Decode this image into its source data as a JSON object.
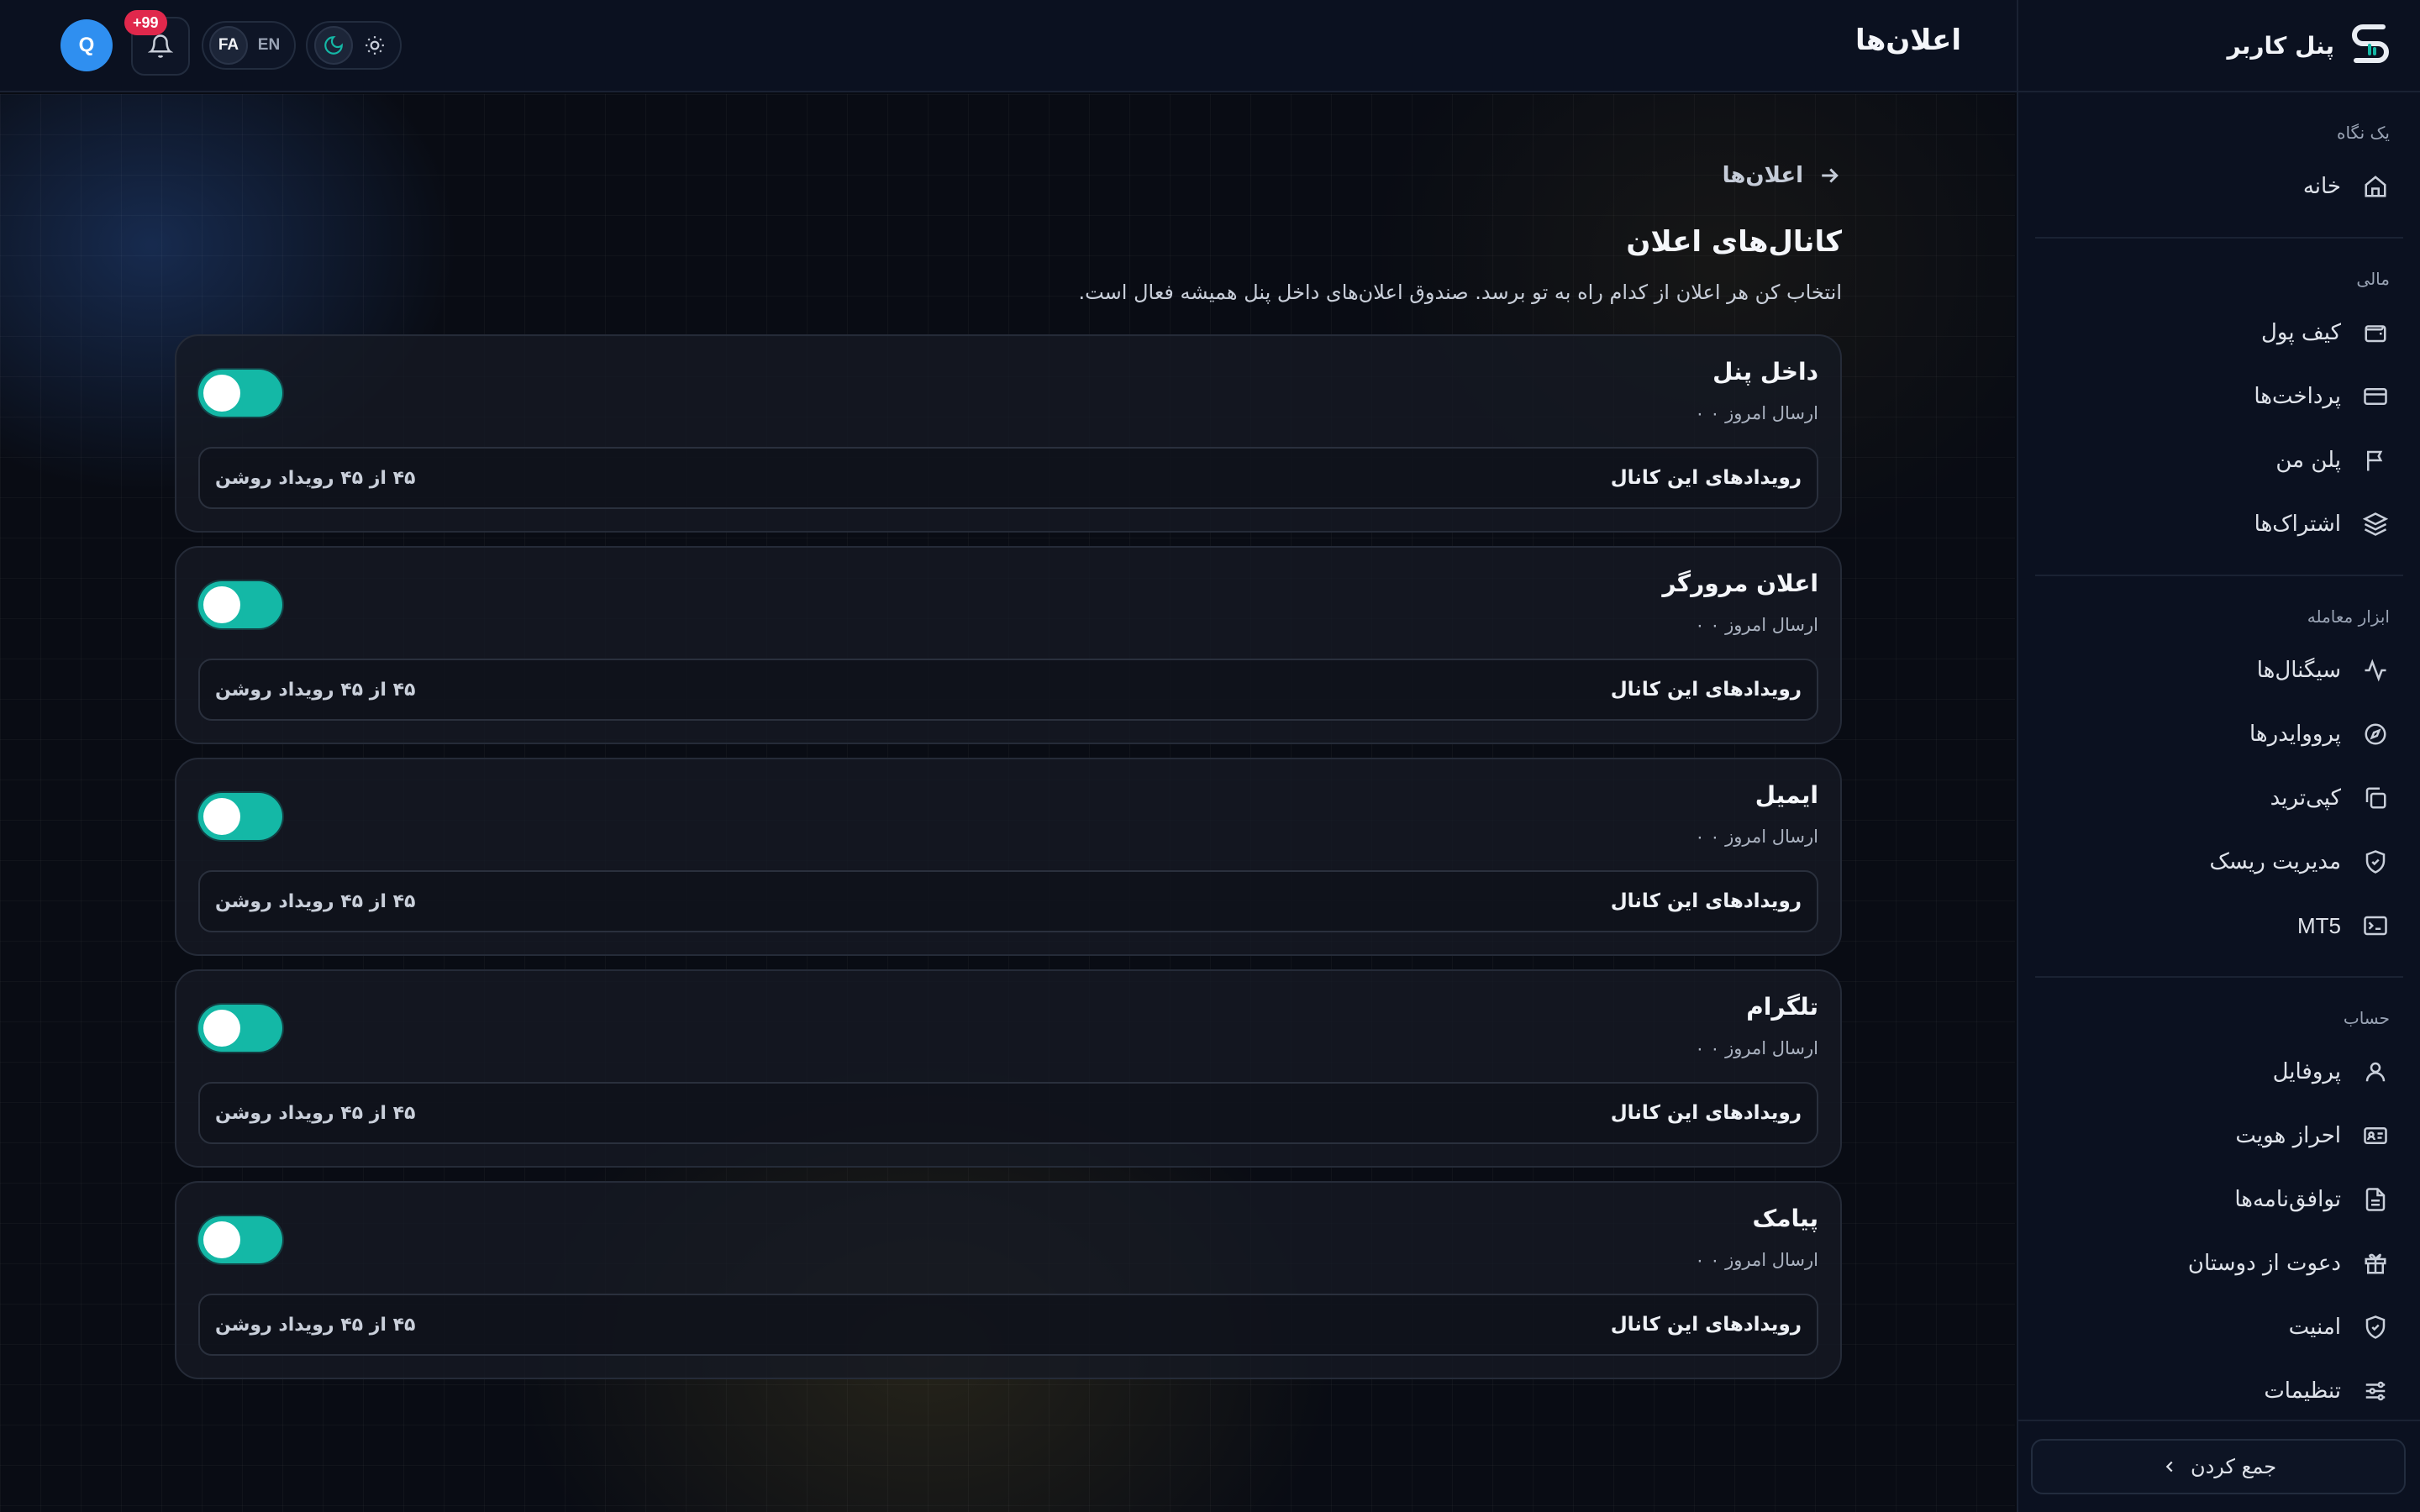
{
  "app": {
    "title": "پنل کاربر",
    "page_title": "اعلان‌ها",
    "collapse_label": "جمع کردن"
  },
  "topbar": {
    "avatar_initial": "Q",
    "notifications_badge": "+99",
    "lang_fa": "FA",
    "lang_en": "EN",
    "active_lang": "FA",
    "active_theme": "dark"
  },
  "sidebar": {
    "groups": [
      {
        "label": "یک نگاه",
        "items": [
          {
            "label": "خانه",
            "icon": "home-icon"
          }
        ]
      },
      {
        "label": "مالی",
        "items": [
          {
            "label": "کیف پول",
            "icon": "wallet-icon"
          },
          {
            "label": "پرداخت‌ها",
            "icon": "credit-card-icon"
          },
          {
            "label": "پلن من",
            "icon": "flag-icon"
          },
          {
            "label": "اشتراک‌ها",
            "icon": "layers-icon"
          }
        ]
      },
      {
        "label": "ابزار معامله",
        "items": [
          {
            "label": "سیگنال‌ها",
            "icon": "activity-icon"
          },
          {
            "label": "پرووایدرها",
            "icon": "compass-icon"
          },
          {
            "label": "کپی‌ترید",
            "icon": "copy-icon"
          },
          {
            "label": "مدیریت ریسک",
            "icon": "shield-check-icon"
          },
          {
            "label": "MT5",
            "icon": "terminal-icon"
          }
        ]
      },
      {
        "label": "حساب",
        "items": [
          {
            "label": "پروفایل",
            "icon": "user-icon"
          },
          {
            "label": "احراز هویت",
            "icon": "id-card-icon"
          },
          {
            "label": "توافق‌نامه‌ها",
            "icon": "document-icon"
          },
          {
            "label": "دعوت از دوستان",
            "icon": "gift-icon"
          },
          {
            "label": "امنیت",
            "icon": "shield-check-icon"
          },
          {
            "label": "تنظیمات",
            "icon": "sliders-icon"
          }
        ]
      }
    ]
  },
  "main": {
    "breadcrumb": "اعلان‌ها",
    "heading": "کانال‌های اعلان",
    "subtitle": "انتخاب کن هر اعلان از کدام راه به تو برسد. صندوق اعلان‌های داخل پنل همیشه فعال است.",
    "channels": [
      {
        "name": "داخل پنل",
        "sent_today": "ارسال امروز ۰ ۰",
        "events_label": "رویدادهای این کانال",
        "events_count": "۴۵ از ۴۵ رویداد روشن",
        "enabled": true
      },
      {
        "name": "اعلان مرورگر",
        "sent_today": "ارسال امروز ۰ ۰",
        "events_label": "رویدادهای این کانال",
        "events_count": "۴۵ از ۴۵ رویداد روشن",
        "enabled": true
      },
      {
        "name": "ایمیل",
        "sent_today": "ارسال امروز ۰ ۰",
        "events_label": "رویدادهای این کانال",
        "events_count": "۴۵ از ۴۵ رویداد روشن",
        "enabled": true
      },
      {
        "name": "تلگرام",
        "sent_today": "ارسال امروز ۰ ۰",
        "events_label": "رویدادهای این کانال",
        "events_count": "۴۵ از ۴۵ رویداد روشن",
        "enabled": true
      },
      {
        "name": "پیامک",
        "sent_today": "ارسال امروز ۰ ۰",
        "events_label": "رویدادهای این کانال",
        "events_count": "۴۵ از ۴۵ رویداد روشن",
        "enabled": true
      }
    ]
  },
  "colors": {
    "accent": "#14b8a6",
    "badge": "#e0284c",
    "avatar": "#2f8ff0",
    "background": "#090c14"
  }
}
